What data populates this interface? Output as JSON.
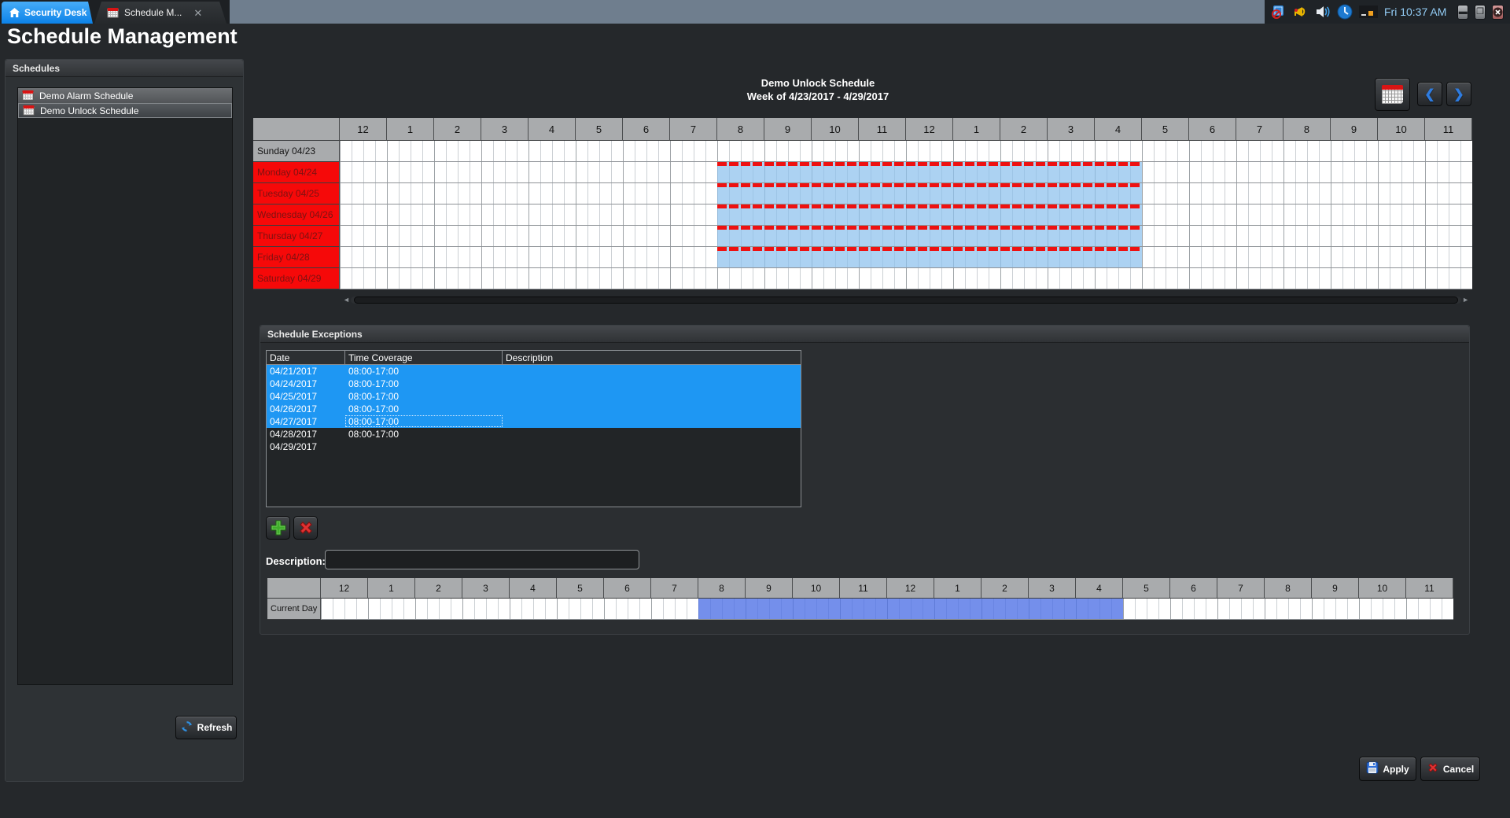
{
  "titlebar": {
    "home_tab": "Security Desk",
    "doc_tab": "Schedule M...",
    "clock": "Fri 10:37 AM"
  },
  "page": {
    "title": "Schedule Management"
  },
  "sidebar": {
    "header": "Schedules",
    "items": [
      {
        "label": "Demo Alarm Schedule",
        "selected": false
      },
      {
        "label": "Demo Unlock Schedule",
        "selected": true
      }
    ],
    "refresh_label": "Refresh"
  },
  "week_view": {
    "title_line1": "Demo Unlock Schedule",
    "title_line2": "Week of 4/23/2017 - 4/29/2017",
    "hours": [
      "12",
      "1",
      "2",
      "3",
      "4",
      "5",
      "6",
      "7",
      "8",
      "9",
      "10",
      "11",
      "12",
      "1",
      "2",
      "3",
      "4",
      "5",
      "6",
      "7",
      "8",
      "9",
      "10",
      "11"
    ],
    "days": [
      {
        "label": "Sunday 04/23",
        "header": "gray",
        "coverage": null
      },
      {
        "label": "Monday 04/24",
        "header": "red",
        "coverage": {
          "start": 8,
          "end": 17
        }
      },
      {
        "label": "Tuesday 04/25",
        "header": "red",
        "coverage": {
          "start": 8,
          "end": 17
        }
      },
      {
        "label": "Wednesday 04/26",
        "header": "red",
        "coverage": {
          "start": 8,
          "end": 17
        }
      },
      {
        "label": "Thursday 04/27",
        "header": "red",
        "coverage": {
          "start": 8,
          "end": 17
        }
      },
      {
        "label": "Friday 04/28",
        "header": "red",
        "coverage": {
          "start": 8,
          "end": 17
        }
      },
      {
        "label": "Saturday 04/29",
        "header": "red",
        "coverage": null
      }
    ],
    "colors": {
      "day_red": "#f60909",
      "header_gray": "#a9abad",
      "coverage_blue": "#8cc1ed",
      "schedule_red_dash": "#ee1111"
    }
  },
  "exceptions": {
    "header": "Schedule Exceptions",
    "columns": [
      "Date",
      "Time Coverage",
      "Description"
    ],
    "rows": [
      {
        "date": "04/21/2017",
        "time": "08:00-17:00",
        "description": "",
        "selected": true,
        "focused": false
      },
      {
        "date": "04/24/2017",
        "time": "08:00-17:00",
        "description": "",
        "selected": true,
        "focused": false
      },
      {
        "date": "04/25/2017",
        "time": "08:00-17:00",
        "description": "",
        "selected": true,
        "focused": false
      },
      {
        "date": "04/26/2017",
        "time": "08:00-17:00",
        "description": "",
        "selected": true,
        "focused": false
      },
      {
        "date": "04/27/2017",
        "time": "08:00-17:00",
        "description": "",
        "selected": true,
        "focused": true
      },
      {
        "date": "04/28/2017",
        "time": "08:00-17:00",
        "description": "",
        "selected": false,
        "focused": false
      },
      {
        "date": "04/29/2017",
        "time": "",
        "description": "",
        "selected": false,
        "focused": false
      }
    ],
    "selected_row_color": "#1e97f3",
    "description_label": "Description:",
    "description_value": "",
    "current_day": {
      "label": "Current Day",
      "coverage_start": 8,
      "coverage_end": 17,
      "fill_color": "#4d70e5"
    }
  },
  "footer": {
    "apply": "Apply",
    "cancel": "Cancel"
  }
}
